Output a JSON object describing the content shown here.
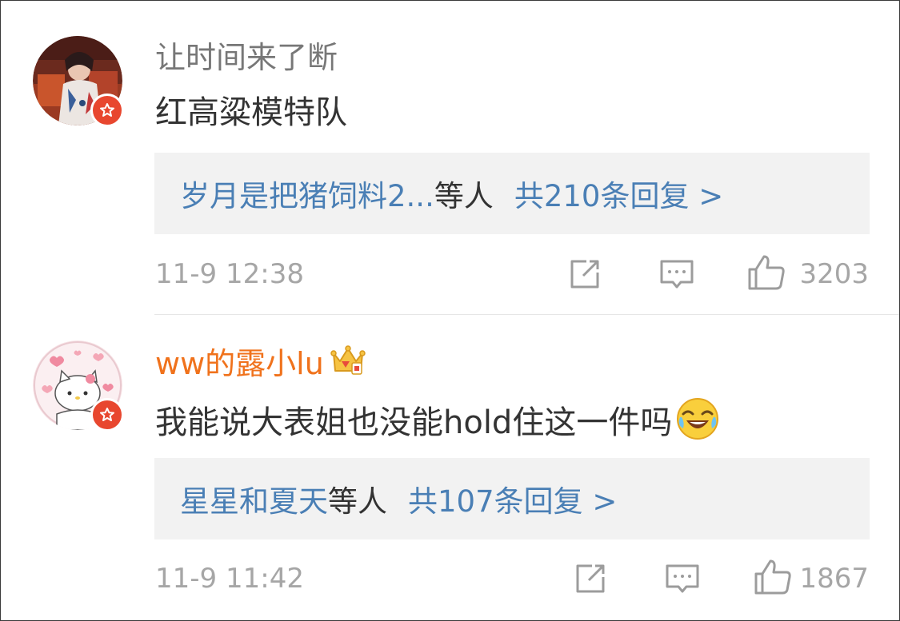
{
  "comments": [
    {
      "username": "让时间来了断",
      "text": "红高粱模特队",
      "reply_names": "岁月是把猪饲料2...",
      "reply_suffix": "等人",
      "reply_total": "共210条回复 >",
      "time": "11-9 12:38",
      "likes": "3203",
      "badge": "verified-badge",
      "avatar": "avatar-photo"
    },
    {
      "username": "ww的露小lu",
      "text": "我能说大表姐也没能hold住这一件吗",
      "reply_names": "星星和夏天",
      "reply_suffix": "等人",
      "reply_total": "共107条回复 >",
      "time": "11-9 11:42",
      "likes": "1867",
      "badge": "verified-badge",
      "avatar": "avatar-hello-kitty"
    }
  ],
  "colors": {
    "link": "#4a7fb5",
    "vip_name": "#f0721c",
    "meta": "#a6a6a6",
    "badge": "#e8472f"
  }
}
